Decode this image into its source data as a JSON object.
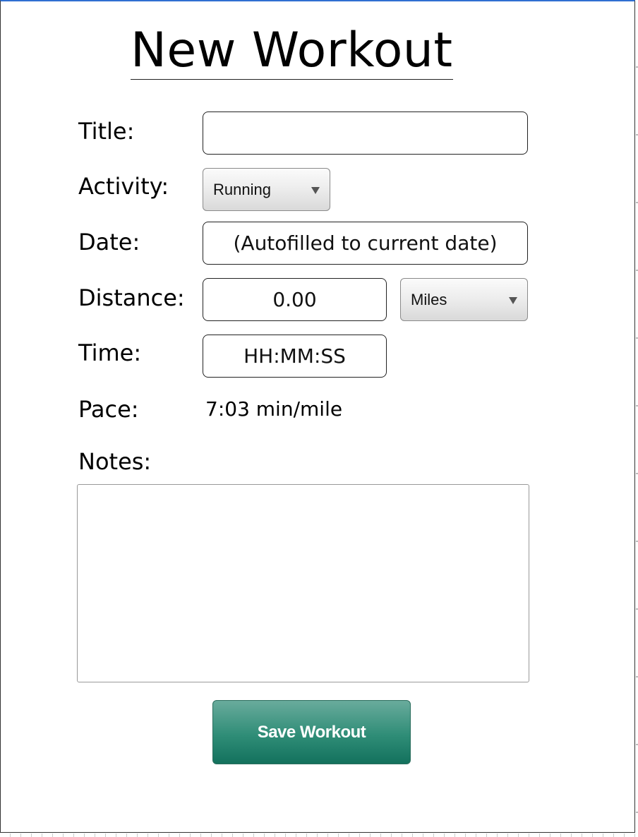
{
  "page": {
    "title": "New Workout"
  },
  "form": {
    "title_label": "Title:",
    "title_value": "",
    "activity_label": "Activity:",
    "activity_selected": "Running",
    "date_label": "Date:",
    "date_value": "(Autofilled to current date)",
    "distance_label": "Distance:",
    "distance_value": "0.00",
    "distance_unit_selected": "Miles",
    "time_label": "Time:",
    "time_value": "HH:MM:SS",
    "pace_label": "Pace:",
    "pace_value": "7:03 min/mile",
    "notes_label": "Notes:",
    "notes_value": ""
  },
  "actions": {
    "save_label": "Save Workout"
  },
  "colors": {
    "frame_top_border": "#2f6fd1",
    "save_button": "#2f8d77"
  },
  "icons": {
    "dropdown": "chevron-down-icon"
  }
}
